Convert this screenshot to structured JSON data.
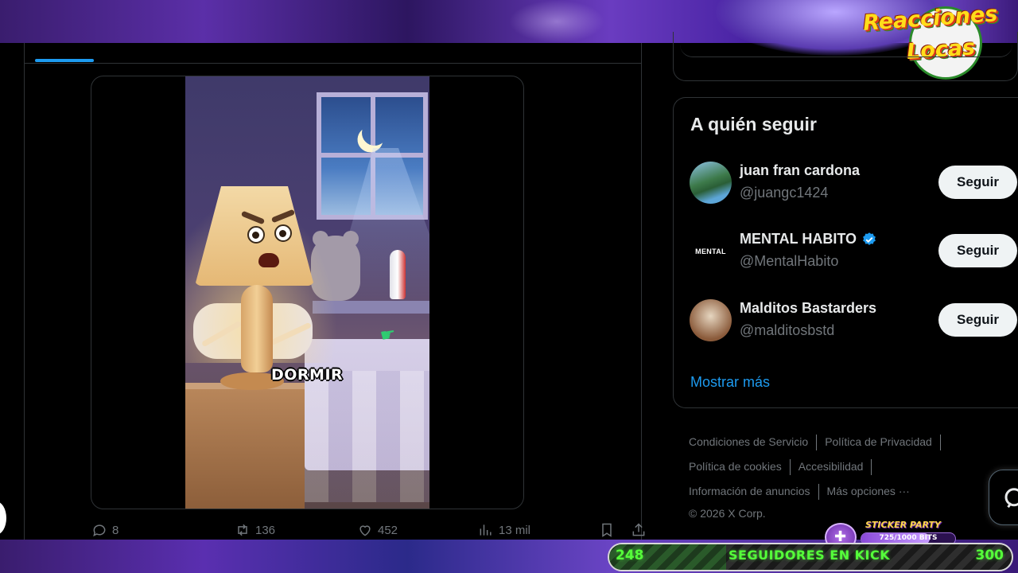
{
  "overlay": {
    "logo_line1": "Reacciones",
    "logo_line2": "Locas"
  },
  "tweet": {
    "video_caption": "DORMIR",
    "actions": {
      "replies": "8",
      "reposts": "136",
      "likes": "452",
      "views": "13 mil"
    }
  },
  "who_to_follow": {
    "title": "A quién seguir",
    "users": [
      {
        "name": "juan fran cardona",
        "handle": "@juangc1424",
        "button": "Seguir",
        "verified": false
      },
      {
        "name": "MENTAL HABITO",
        "handle": "@MentalHabito",
        "button": "Seguir",
        "verified": true,
        "avatar_text": "MENTAL"
      },
      {
        "name": "Malditos Bastarders",
        "handle": "@malditosbstd",
        "button": "Seguir",
        "verified": false
      }
    ],
    "show_more": "Mostrar más"
  },
  "footer": {
    "links": [
      "Condiciones de Servicio",
      "Política de Privacidad",
      "Política de cookies",
      "Accesibilidad",
      "Información de anuncios",
      "Más opciones ···"
    ],
    "copyright": "© 2026 X Corp."
  },
  "stream_widgets": {
    "sticker_party": {
      "title": "STICKER PARTY",
      "progress_text": "725/1000 BITS",
      "progress": 0.725
    },
    "kick_goal": {
      "start": "248",
      "label": "SEGUIDORES EN KICK",
      "end": "300",
      "progress": 0.29
    }
  },
  "colors": {
    "accent": "#1d9bf0",
    "muted": "#71767b",
    "border": "#2f3336",
    "kick_green": "#55ff3a"
  }
}
